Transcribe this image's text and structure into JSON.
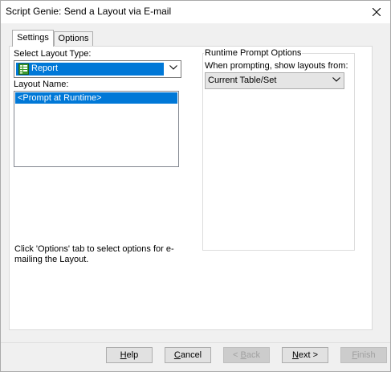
{
  "window": {
    "title": "Script Genie:  Send a Layout via E-mail"
  },
  "tabs": [
    {
      "label": "Settings",
      "active": true
    },
    {
      "label": "Options",
      "active": false
    }
  ],
  "settings": {
    "layout_type_label": "Select Layout Type:",
    "layout_type_value": "Report",
    "layout_type_icon": "report-icon",
    "layout_name_label": "Layout Name:",
    "layout_name_items": [
      "<Prompt at Runtime>"
    ],
    "selected_index": 0,
    "hint_text": "Click 'Options' tab to select options for e-mailing the Layout."
  },
  "runtime_prompt": {
    "group_title": "Runtime Prompt Options",
    "prompt_label": "When prompting, show layouts from:",
    "prompt_value": "Current Table/Set"
  },
  "buttons": {
    "help": {
      "pre": "",
      "mnemonic": "H",
      "post": "elp",
      "enabled": true
    },
    "cancel": {
      "pre": "",
      "mnemonic": "C",
      "post": "ancel",
      "enabled": true
    },
    "back": {
      "pre": "< ",
      "mnemonic": "B",
      "post": "ack",
      "enabled": false
    },
    "next": {
      "pre": "",
      "mnemonic": "N",
      "post": "ext >",
      "enabled": true
    },
    "finish": {
      "pre": "",
      "mnemonic": "F",
      "post": "inish",
      "enabled": false
    }
  },
  "colors": {
    "selection": "#0078d7",
    "window_bg": "#f0f0f0",
    "panel_bg": "#ffffff"
  }
}
